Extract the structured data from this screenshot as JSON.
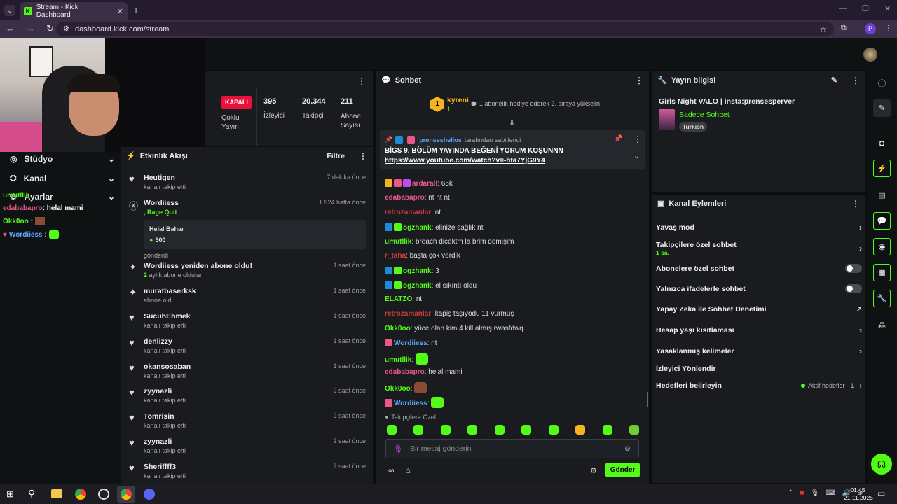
{
  "browser": {
    "tab_title": "Stream - Kick Dashboard",
    "url": "dashboard.kick.com/stream",
    "profile_initial": "P"
  },
  "colors": {
    "accent": "#53fc18",
    "live_badge": "#e9113c",
    "panel": "#191b1f"
  },
  "sidenav": {
    "items": [
      {
        "label": "Stüdyo",
        "icon": "studio-icon"
      },
      {
        "label": "Kanal",
        "icon": "channel-icon"
      },
      {
        "label": "Ayarlar",
        "icon": "settings-icon"
      }
    ],
    "overlay_chat": [
      {
        "user": "umutllik",
        "text": ""
      },
      {
        "user": "edababapro",
        "text": ": helal mami"
      },
      {
        "user": "Okk0oo",
        "text": ":"
      },
      {
        "user": "Wordiiess",
        "text": ":"
      }
    ]
  },
  "stats": {
    "live_status": "KAPALI",
    "multistream": "Çoklu Yayın",
    "viewers": {
      "value": "395",
      "label": "İzleyici"
    },
    "followers": {
      "value": "20.344",
      "label": "Takipçi"
    },
    "subs": {
      "value": "211",
      "label": "Abone Sayısı"
    }
  },
  "activity": {
    "title": "Etkinlik Akışı",
    "filter": "Filtre",
    "items": [
      {
        "name": "Heutigen",
        "sub": "kanalı takip etti",
        "time": "7 dakika önce",
        "icon": "heart-icon"
      },
      {
        "name": "Wordiiess",
        "sub": ", Rage Quit",
        "time": "1.924 hafta önce",
        "icon": "kick-icon",
        "card_title": "Helal Bahar",
        "card_amount": "500",
        "after": "gönderdi"
      },
      {
        "name": "Wordiiess yeniden abone oldu!",
        "sub_count": "2",
        "sub": " aylık abone oldular",
        "time": "1 saat önce",
        "icon": "sparkle-icon"
      },
      {
        "name": "muratbaserksk",
        "sub": "abone oldu",
        "time": "1 saat önce",
        "icon": "sparkle-icon"
      },
      {
        "name": "SucuhEhmek",
        "sub": "kanalı takip etti",
        "time": "1 saat önce",
        "icon": "heart-icon"
      },
      {
        "name": "denlizzy",
        "sub": "kanalı takip etti",
        "time": "1 saat önce",
        "icon": "heart-icon"
      },
      {
        "name": "okansosaban",
        "sub": "kanalı takip etti",
        "time": "1 saat önce",
        "icon": "heart-icon"
      },
      {
        "name": "zyynazli",
        "sub": "kanalı takip etti",
        "time": "2 saat önce",
        "icon": "heart-icon"
      },
      {
        "name": "Tomrisin",
        "sub": "kanalı takip etti",
        "time": "2 saat önce",
        "icon": "heart-icon"
      },
      {
        "name": "zyynazli",
        "sub": "kanalı takip etti",
        "time": "2 saat önce",
        "icon": "heart-icon"
      },
      {
        "name": "Sheriffff3",
        "sub": "kanalı takip etti",
        "time": "2 saat önce",
        "icon": "heart-icon"
      }
    ]
  },
  "chat": {
    "title": "Sohbet",
    "top_gifter": {
      "rank": "1",
      "name": "kyreni",
      "count": "1"
    },
    "gift_prompt": "1 abonelik hediye ederek 2. sıraya yükselin",
    "pinned": {
      "by_user": "prenseshelios",
      "by_text": "tarafından sabitlendi",
      "text": "BİGS 9. BÖLÜM YAYINDA BEĞENİ YORUM KOŞUNNN",
      "link": "https://www.youtube.com/watch?v=-hta7YjG9Y4"
    },
    "messages": [
      {
        "user": "ardarall",
        "text": ": 65k",
        "color": "#e8598a"
      },
      {
        "user": "edababapro",
        "text": ": nt nt nt",
        "color": "#e8598a"
      },
      {
        "user": "retrozamanlar",
        "text": ": nt",
        "color": "#d23b3b"
      },
      {
        "user": "ogzhank",
        "text": ": elinize sağlık nt",
        "color": "#53fc18"
      },
      {
        "user": "umutllik",
        "text": ": breach dicektm la brim demişim",
        "color": "#53fc18"
      },
      {
        "user": "r_taha",
        "text": ": başta çok verdik",
        "color": "#d23b3b"
      },
      {
        "user": "ogzhank",
        "text": ": 3",
        "color": "#53fc18"
      },
      {
        "user": "ogzhank",
        "text": ": el sıkıntı oldu",
        "color": "#53fc18"
      },
      {
        "user": "ELATZO",
        "text": ": nt",
        "color": "#53fc18"
      },
      {
        "user": "retrozamanlar",
        "text": ": kapiş taşıyodu 11 vurmuş",
        "color": "#d23b3b"
      },
      {
        "user": "Okk0oo",
        "text": ": yüce olan kim 4 kill almış rwasfdwq",
        "color": "#53fc18"
      },
      {
        "user": "Wordiiess",
        "text": ": nt",
        "color": "#5aa6ff"
      },
      {
        "user": "umutllik",
        "text": ":",
        "color": "#53fc18"
      },
      {
        "user": "edababapro",
        "text": ": helal mami",
        "color": "#e8598a"
      },
      {
        "user": "Okk0oo",
        "text": ":",
        "color": "#53fc18"
      },
      {
        "user": "Wordiiess",
        "text": ":",
        "color": "#5aa6ff"
      }
    ],
    "followers_only": "Takipçilere Özel",
    "input_placeholder": "Bir mesaj gönderin",
    "send": "Gönder"
  },
  "stream_info": {
    "title": "Yayın bilgisi",
    "stream_title": "Girls Night VALO | insta:prensesperver",
    "category": "Sadece Sohbet",
    "tag": "Turkish"
  },
  "channel_actions": {
    "title": "Kanal Eylemleri",
    "items": [
      {
        "label": "Yavaş mod",
        "control": "chevron"
      },
      {
        "label": "Takipçilere özel sohbet",
        "sub": "1 sa.",
        "control": "chevron"
      },
      {
        "label": "Abonelere özel sohbet",
        "control": "toggle"
      },
      {
        "label": "Yalnızca ifadelerle sohbet",
        "control": "toggle"
      },
      {
        "label": "Yapay Zeka ile Sohbet Denetimi",
        "control": "external"
      },
      {
        "label": "Hesap yaşı kısıtlaması",
        "control": "chevron"
      },
      {
        "label": "Yasaklanmış kelimeler",
        "control": "chevron"
      },
      {
        "label": "İzleyici Yönlendir",
        "control": "none"
      },
      {
        "label": "Hedefleri belirleyin",
        "status": "Aktif hedefler - 1",
        "control": "chevron"
      }
    ]
  },
  "taskbar": {
    "time": "01:45",
    "date": "21.11.2025"
  }
}
